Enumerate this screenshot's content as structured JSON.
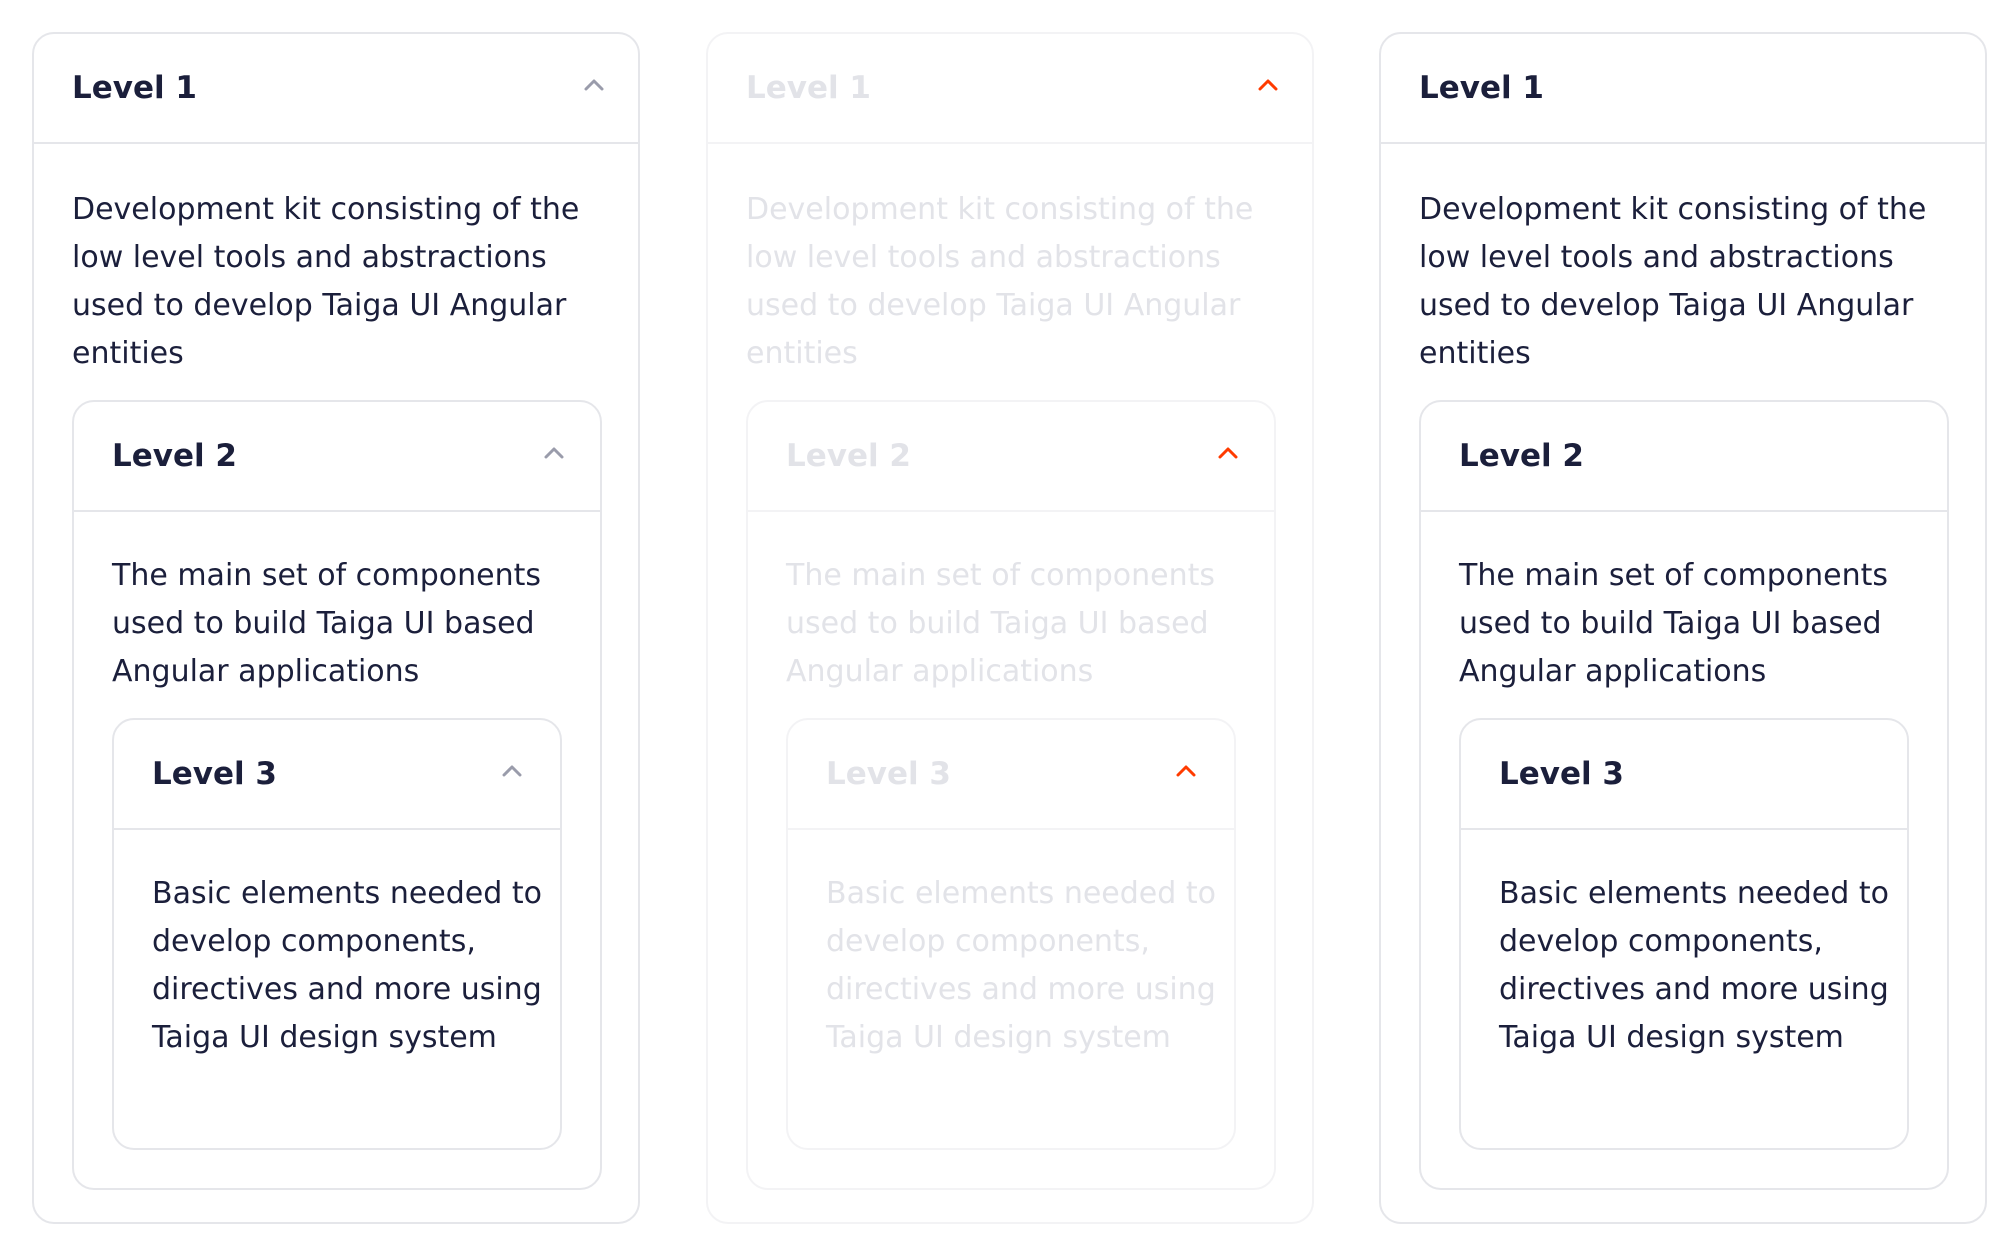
{
  "panels": [
    {
      "state": "default",
      "level1": {
        "title": "Level 1",
        "text": "Development kit consisting of the low level tools and abstractions used to develop Taiga UI Angular entities"
      },
      "level2": {
        "title": "Level 2",
        "text": "The main set of components used to build Taiga UI based Angular applications"
      },
      "level3": {
        "title": "Level 3",
        "text": "Basic elements needed to develop components, directives and more using Taiga UI design system"
      },
      "chevron_icon": "chevron-up-icon",
      "chevron_color": "#9a9cab"
    },
    {
      "state": "disabled",
      "level1": {
        "title": "Level 1",
        "text": "Development kit consisting of the low level tools and abstractions used to develop Taiga UI Angular entities"
      },
      "level2": {
        "title": "Level 2",
        "text": "The main set of components used to build Taiga UI based Angular applications"
      },
      "level3": {
        "title": "Level 3",
        "text": "Basic elements needed to develop components, directives and more using Taiga UI design system"
      },
      "chevron_icon": "chevron-up-icon",
      "chevron_color": "#ff3b00"
    },
    {
      "state": "no-chevron",
      "level1": {
        "title": "Level 1",
        "text": "Development kit consisting of the low level tools and abstractions used to develop Taiga UI Angular entities"
      },
      "level2": {
        "title": "Level 2",
        "text": "The main set of components used to build Taiga UI based Angular applications"
      },
      "level3": {
        "title": "Level 3",
        "text": "Basic elements needed to develop components, directives and more using Taiga UI design system"
      }
    }
  ],
  "colors": {
    "text": "#1b1f3b",
    "border": "#e5e6ea",
    "disabled_text": "#e2e3e8",
    "accent": "#ff3b00"
  }
}
